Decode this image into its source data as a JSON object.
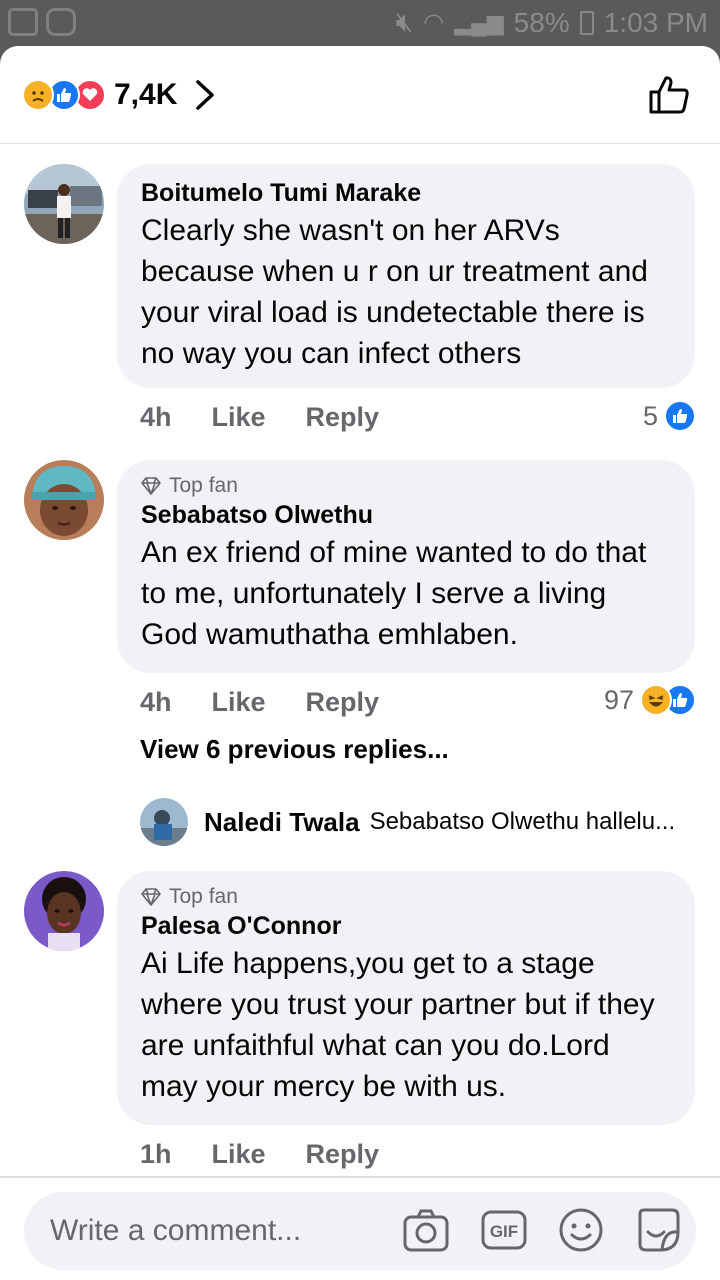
{
  "status_bar": {
    "battery": "58%",
    "time": "1:03 PM"
  },
  "header": {
    "reaction_count": "7,4K"
  },
  "comments": [
    {
      "author": "Boitumelo Tumi Marake",
      "text": "Clearly she wasn't on her ARVs because when u r on ur treatment and your viral load is undetectable there is no way you can infect others",
      "time": "4h",
      "like": "Like",
      "reply": "Reply",
      "reaction_count": "5"
    },
    {
      "badge": "Top fan",
      "author": "Sebabatso Olwethu",
      "text": "An ex friend of mine wanted to do that to me, unfortunately I serve a living God wamuthatha emhlaben.",
      "time": "4h",
      "like": "Like",
      "reply": "Reply",
      "reaction_count": "97"
    },
    {
      "badge": "Top fan",
      "author": "Palesa O'Connor",
      "text": "Ai Life happens,you get to a stage where you trust your partner but if they are unfaithful what can you do.Lord may your mercy be with us.",
      "time": "1h",
      "like": "Like",
      "reply": "Reply"
    }
  ],
  "replies_link": "View 6 previous replies...",
  "latest_reply": {
    "author": "Naledi Twala",
    "text": "Sebabatso Olwethu hallelu..."
  },
  "composer": {
    "placeholder": "Write a comment..."
  },
  "colors": {
    "accent": "#1877f2",
    "bubble": "#f0f2f5",
    "muted": "#65676b"
  }
}
